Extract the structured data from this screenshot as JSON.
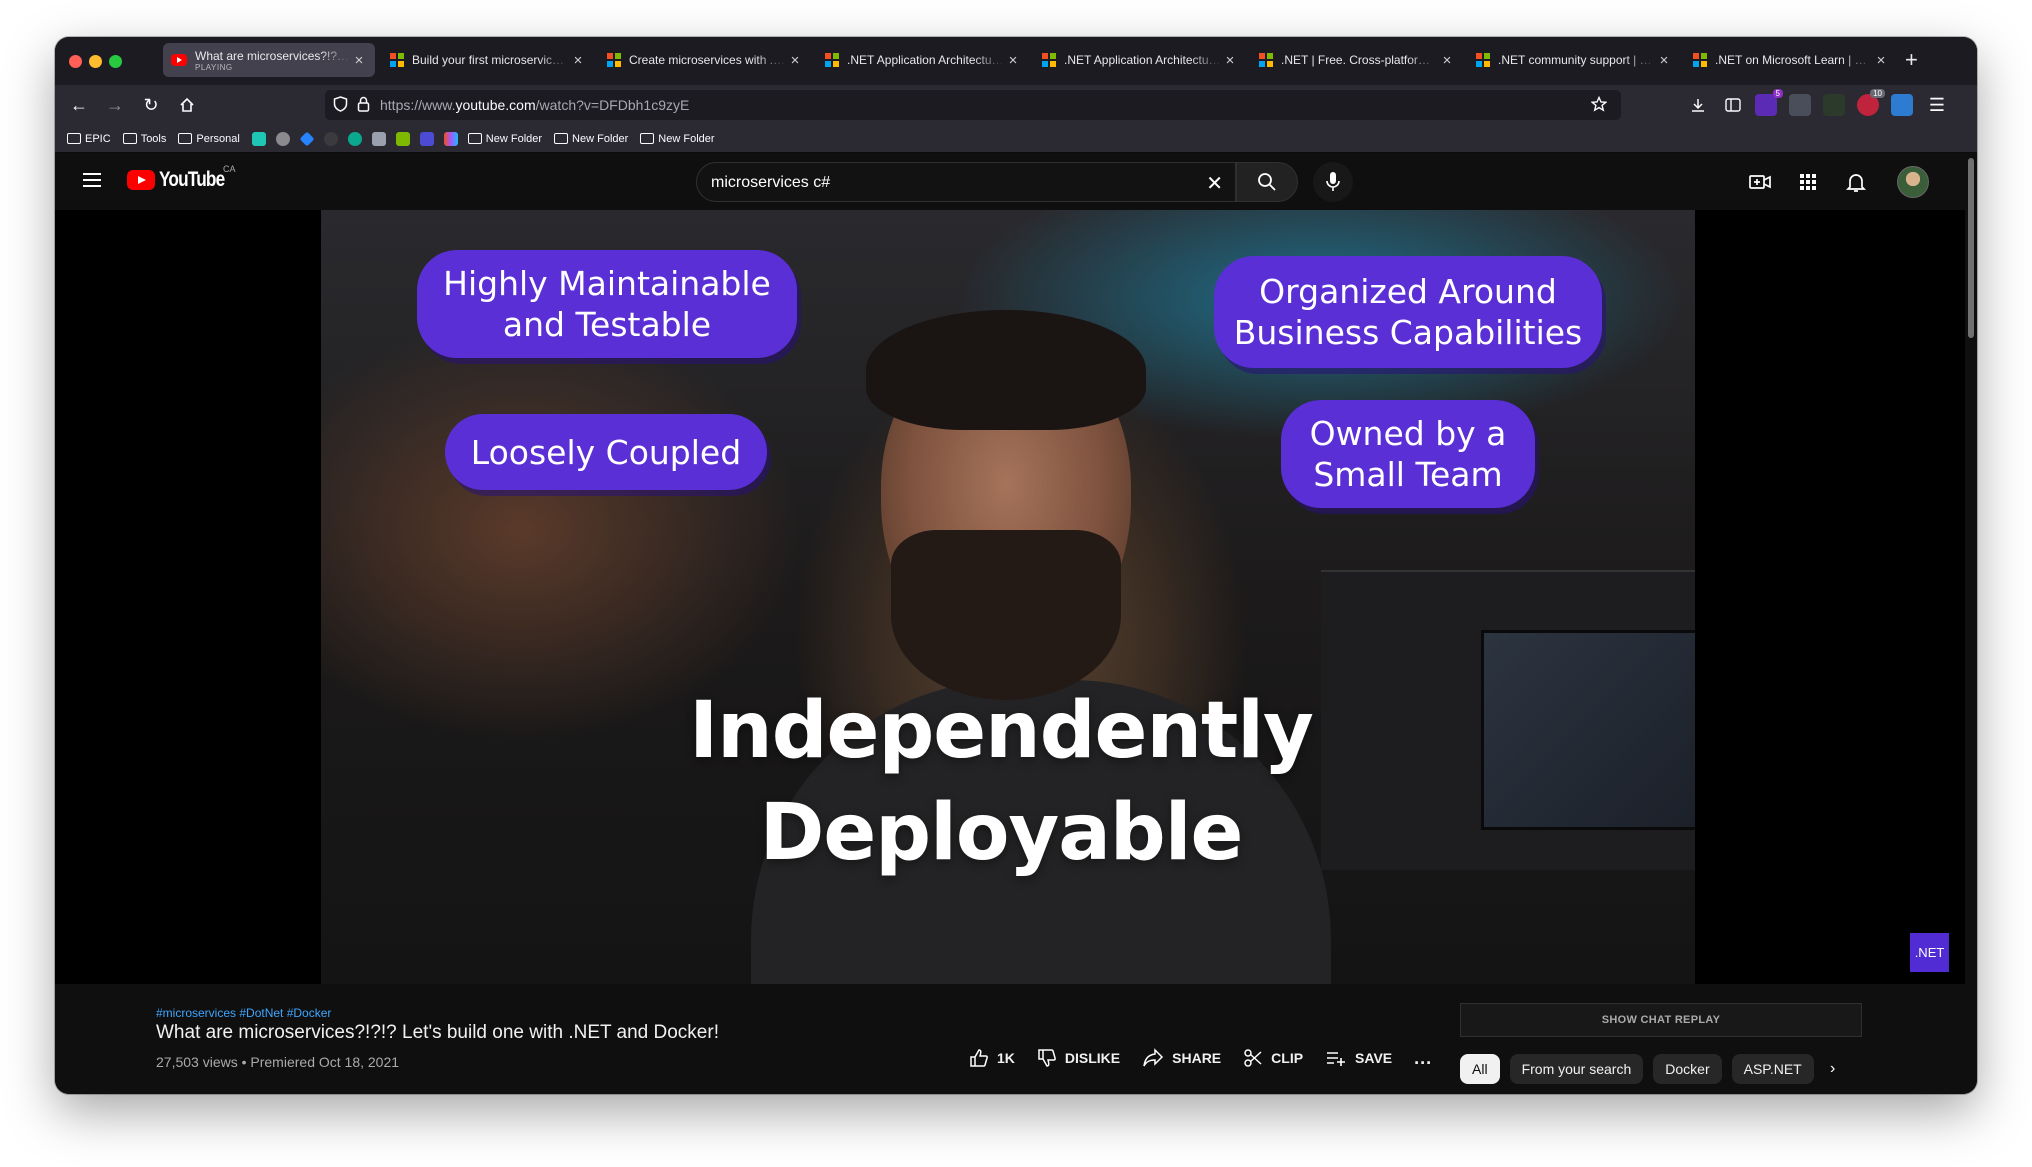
{
  "browser": {
    "tabs": [
      {
        "label": "What are microservices?!?!? Let's build one with .NET and Docker!",
        "sub": "PLAYING",
        "favicon": "youtube-icon",
        "active": true
      },
      {
        "label": "Build your first microservice with .NET",
        "favicon": "microsoft-icon"
      },
      {
        "label": "Create microservices with .NET and ASP.NET",
        "favicon": "microsoft-icon"
      },
      {
        "label": ".NET Application Architecture Guides",
        "favicon": "microsoft-icon"
      },
      {
        "label": ".NET Application Architecture Guides",
        "favicon": "microsoft-icon"
      },
      {
        "label": ".NET | Free. Cross-platform. Open Source.",
        "favicon": "microsoft-icon"
      },
      {
        "label": ".NET community support | Microsoft",
        "favicon": "microsoft-icon"
      },
      {
        "label": ".NET on Microsoft Learn | Microsoft",
        "favicon": "microsoft-icon"
      }
    ],
    "url_prefix": "https://www.",
    "url_domain": "youtube.com",
    "url_path": "/watch?v=DFDbh1c9zyE",
    "bookmarks": {
      "epic": "EPIC",
      "tools": "Tools",
      "personal": "Personal",
      "folder1": "New Folder",
      "folder2": "New Folder",
      "folder3": "New Folder"
    },
    "ext_badges": {
      "ext1": "5",
      "ext2": "10"
    }
  },
  "youtube": {
    "logo_text": "YouTube",
    "country": "CA",
    "search_value": "microservices c#"
  },
  "video": {
    "bubbles": {
      "b1_l1": "Highly Maintainable",
      "b1_l2": "and Testable",
      "b2": "Loosely Coupled",
      "b3_l1": "Organized Around",
      "b3_l2": "Business Capabilities",
      "b4_l1": "Owned by a",
      "b4_l2": "Small Team"
    },
    "headline_l1": "Independently",
    "headline_l2": "Deployable",
    "badge": ".NET"
  },
  "details": {
    "hashtags": "#microservices #DotNet #Docker",
    "title": "What are microservices?!?!? Let's build one with .NET and Docker!",
    "meta": "27,503 views • Premiered Oct 18, 2021",
    "like_count": "1K",
    "dislike": "DISLIKE",
    "share": "SHARE",
    "clip": "CLIP",
    "save": "SAVE",
    "more": "..."
  },
  "sidebar": {
    "chat_replay": "SHOW CHAT REPLAY",
    "chips": [
      "All",
      "From your search",
      "Docker",
      "ASP.NET"
    ]
  },
  "colors": {
    "accent_purple": "#5b2fd6",
    "youtube_red": "#ff0000",
    "link_blue": "#3ea6ff"
  }
}
